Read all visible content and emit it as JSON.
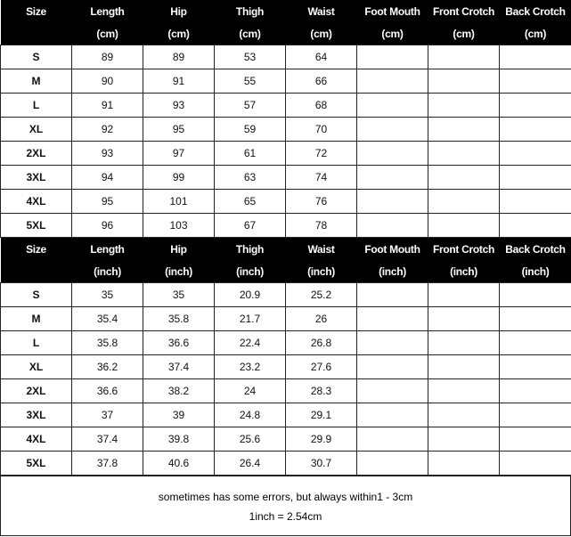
{
  "cm_table": {
    "headers": [
      "Size",
      "Length",
      "Hip",
      "Thigh",
      "Waist",
      "Foot Mouth",
      "Front Crotch",
      "Back Crotch"
    ],
    "units": [
      "",
      "(cm)",
      "(cm)",
      "(cm)",
      "(cm)",
      "(cm)",
      "(cm)",
      "(cm)"
    ],
    "rows": [
      [
        "S",
        "89",
        "89",
        "53",
        "64",
        "",
        "",
        ""
      ],
      [
        "M",
        "90",
        "91",
        "55",
        "66",
        "",
        "",
        ""
      ],
      [
        "L",
        "91",
        "93",
        "57",
        "68",
        "",
        "",
        ""
      ],
      [
        "XL",
        "92",
        "95",
        "59",
        "70",
        "",
        "",
        ""
      ],
      [
        "2XL",
        "93",
        "97",
        "61",
        "72",
        "",
        "",
        ""
      ],
      [
        "3XL",
        "94",
        "99",
        "63",
        "74",
        "",
        "",
        ""
      ],
      [
        "4XL",
        "95",
        "101",
        "65",
        "76",
        "",
        "",
        ""
      ],
      [
        "5XL",
        "96",
        "103",
        "67",
        "78",
        "",
        "",
        ""
      ]
    ]
  },
  "inch_table": {
    "headers": [
      "Size",
      "Length",
      "Hip",
      "Thigh",
      "Waist",
      "Foot Mouth",
      "Front Crotch",
      "Back Crotch"
    ],
    "units": [
      "",
      "(inch)",
      "(inch)",
      "(inch)",
      "(inch)",
      "(inch)",
      "(inch)",
      "(inch)"
    ],
    "rows": [
      [
        "S",
        "35",
        "35",
        "20.9",
        "25.2",
        "",
        "",
        ""
      ],
      [
        "M",
        "35.4",
        "35.8",
        "21.7",
        "26",
        "",
        "",
        ""
      ],
      [
        "L",
        "35.8",
        "36.6",
        "22.4",
        "26.8",
        "",
        "",
        ""
      ],
      [
        "XL",
        "36.2",
        "37.4",
        "23.2",
        "27.6",
        "",
        "",
        ""
      ],
      [
        "2XL",
        "36.6",
        "38.2",
        "24",
        "28.3",
        "",
        "",
        ""
      ],
      [
        "3XL",
        "37",
        "39",
        "24.8",
        "29.1",
        "",
        "",
        ""
      ],
      [
        "4XL",
        "37.4",
        "39.8",
        "25.6",
        "29.9",
        "",
        "",
        ""
      ],
      [
        "5XL",
        "37.8",
        "40.6",
        "26.4",
        "30.7",
        "",
        "",
        ""
      ]
    ]
  },
  "note": {
    "line1": "sometimes has some errors, but always within1 - 3cm",
    "line2": "1inch = 2.54cm"
  }
}
